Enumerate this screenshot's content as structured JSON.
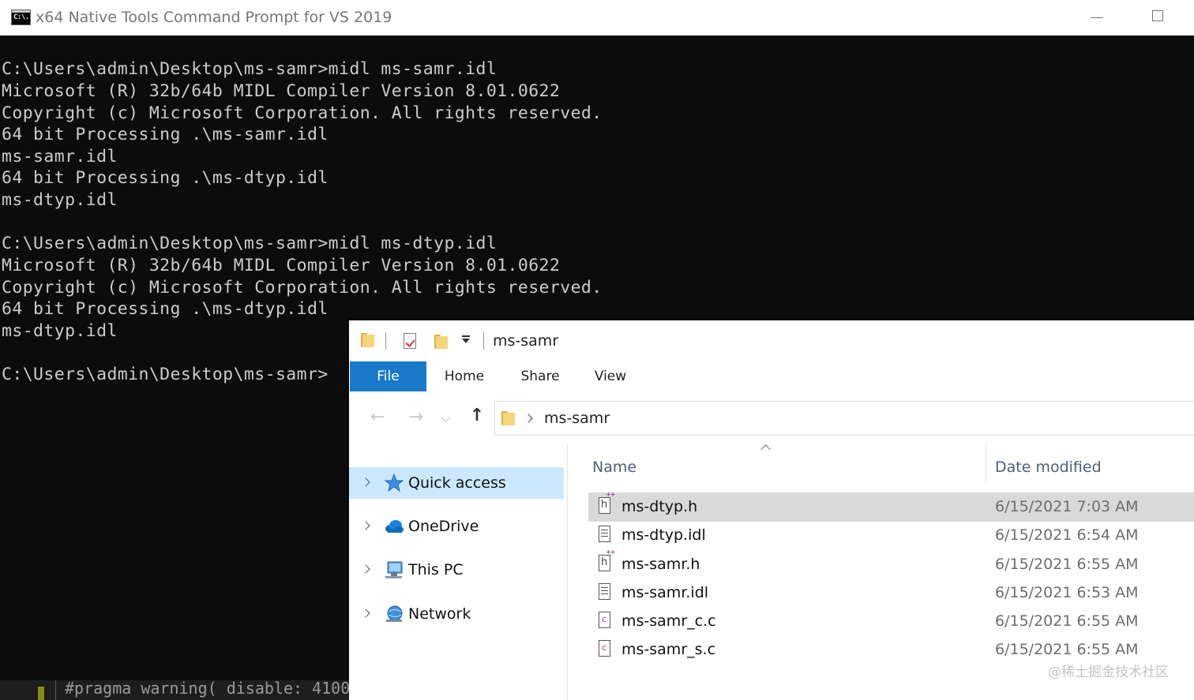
{
  "console": {
    "title": "x64 Native Tools Command Prompt for VS 2019",
    "icon_text": "C:\\.",
    "lines": [
      "C:\\Users\\admin\\Desktop\\ms-samr>midl ms-samr.idl",
      "Microsoft (R) 32b/64b MIDL Compiler Version 8.01.0622",
      "Copyright (c) Microsoft Corporation. All rights reserved.",
      "64 bit Processing .\\ms-samr.idl",
      "ms-samr.idl",
      "64 bit Processing .\\ms-dtyp.idl",
      "ms-dtyp.idl",
      "",
      "C:\\Users\\admin\\Desktop\\ms-samr>midl ms-dtyp.idl",
      "Microsoft (R) 32b/64b MIDL Compiler Version 8.01.0622",
      "Copyright (c) Microsoft Corporation. All rights reserved.",
      "64 bit Processing .\\ms-dtyp.idl",
      "ms-dtyp.idl",
      "",
      "C:\\Users\\admin\\Desktop\\ms-samr>"
    ],
    "background_code": "#pragma warning( disable: 4100"
  },
  "explorer": {
    "title": "ms-samr",
    "ribbon_tabs": [
      "File",
      "Home",
      "Share",
      "View"
    ],
    "address_path": "ms-samr",
    "nav_items": [
      {
        "label": "Quick access",
        "icon": "star-icon",
        "selected": true
      },
      {
        "label": "OneDrive",
        "icon": "cloud-icon",
        "selected": false
      },
      {
        "label": "This PC",
        "icon": "computer-icon",
        "selected": false
      },
      {
        "label": "Network",
        "icon": "network-icon",
        "selected": false
      }
    ],
    "columns": {
      "name": "Name",
      "date_modified": "Date modified"
    },
    "files": [
      {
        "name": "ms-dtyp.h",
        "date": "6/15/2021 7:03 AM",
        "icon": "header-file-icon"
      },
      {
        "name": "ms-dtyp.idl",
        "date": "6/15/2021 6:54 AM",
        "icon": "text-file-icon"
      },
      {
        "name": "ms-samr.h",
        "date": "6/15/2021 6:55 AM",
        "icon": "header-file-icon"
      },
      {
        "name": "ms-samr.idl",
        "date": "6/15/2021 6:53 AM",
        "icon": "text-file-icon"
      },
      {
        "name": "ms-samr_c.c",
        "date": "6/15/2021 6:55 AM",
        "icon": "c-source-file-icon"
      },
      {
        "name": "ms-samr_s.c",
        "date": "6/15/2021 6:55 AM",
        "icon": "c-source-file-icon"
      }
    ]
  },
  "watermark": "@稀土掘金技术社区"
}
